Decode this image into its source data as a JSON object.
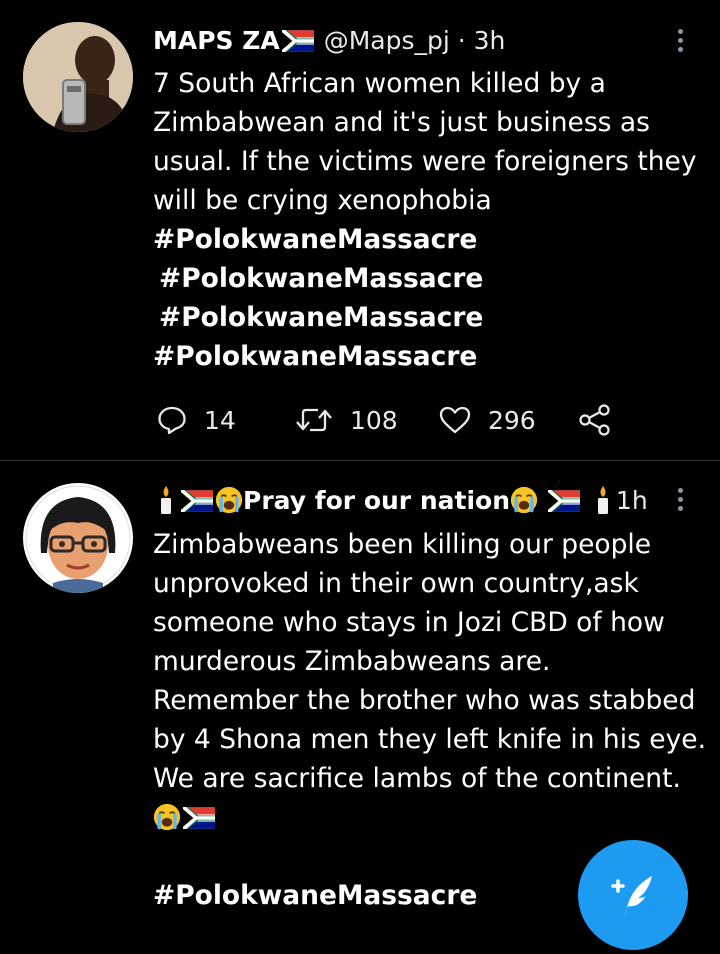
{
  "tweets": [
    {
      "name": "MAPS ZA",
      "handle": "@Maps_pj",
      "separator": "·",
      "time": "3h",
      "body_lines": [
        "7 South African women killed by a",
        "Zimbabwean and it's just business as",
        "usual. If the victims were foreigners they",
        "will be crying xenophobia"
      ],
      "hashtags": [
        "#PolokwaneMassacre",
        " #PolokwaneMassacre",
        " #PolokwaneMassacre",
        "#PolokwaneMassacre"
      ],
      "replies": "14",
      "retweets": "108",
      "likes": "296"
    },
    {
      "name": "Pray for our nation",
      "time": "1h",
      "body_lines": [
        "Zimbabweans been killing our people",
        "unprovoked in their own country,ask",
        "someone who stays in Jozi CBD of how",
        "murderous Zimbabweans are.",
        "Remember the brother who was stabbed",
        "by 4 Shona men they left knife in his eye.",
        "We are sacrifice lambs of the continent."
      ],
      "hashtag": "#PolokwaneMassacre"
    }
  ],
  "icons": {
    "more": "more-vertical-icon",
    "reply": "reply-bubble-icon",
    "retweet": "retweet-icon",
    "like": "heart-icon",
    "share": "share-icon",
    "compose": "compose-feather-icon"
  },
  "colors": {
    "background": "#000000",
    "text": "#ffffff",
    "muted": "#8b98a5",
    "accent": "#1d9bf0"
  }
}
